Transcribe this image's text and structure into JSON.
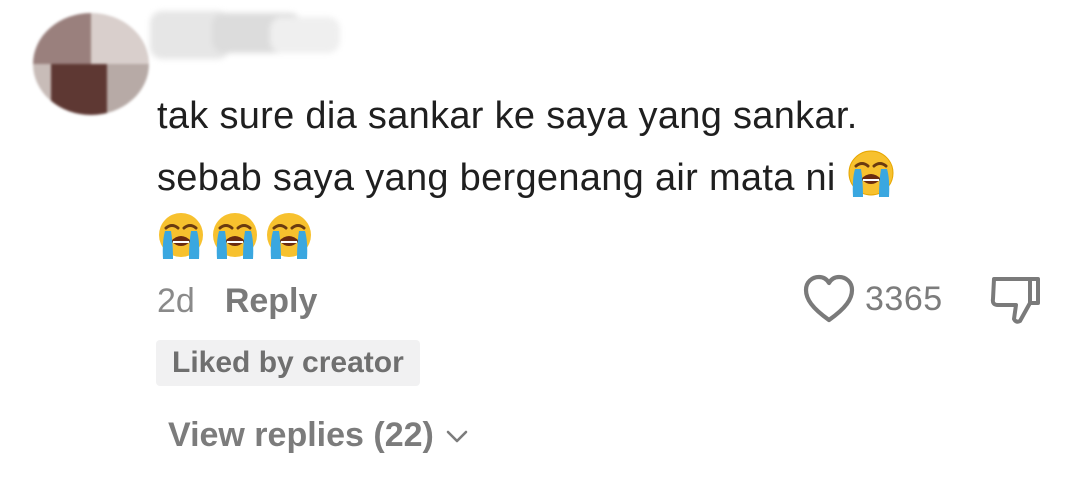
{
  "comment": {
    "username": "",
    "text_line1": "tak sure dia sankar ke saya yang sankar.",
    "text_line2": "sebab saya yang bergenang air mata ni",
    "emoji_line2": "crying-face-emoji",
    "emoji_line3": [
      "crying-face-emoji",
      "crying-face-emoji",
      "crying-face-emoji"
    ],
    "age": "2d",
    "reply_label": "Reply",
    "like_count": "3365",
    "creator_badge": "Liked by creator",
    "view_replies": "View replies (22)"
  },
  "colors": {
    "text": "#1f1f1f",
    "meta": "#8a8a8a",
    "badge_bg": "#f1f1f2",
    "icon": "#7a7a7a"
  },
  "icons": {
    "like": "heart-outline-icon",
    "dislike": "thumbs-down-icon",
    "expand": "chevron-down-icon"
  }
}
